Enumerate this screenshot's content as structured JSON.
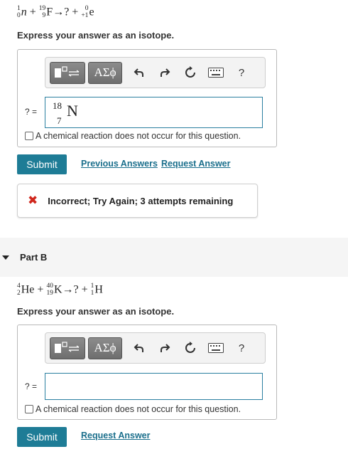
{
  "partA": {
    "equation": {
      "neutron": {
        "mass": "1",
        "atomic": "0",
        "symbol": "n"
      },
      "plus1": "+",
      "fluorine": {
        "mass": "19",
        "atomic": "9",
        "symbol": "F"
      },
      "arrow": "→",
      "unknown": "?",
      "plus2": "+",
      "positron": {
        "mass": "0",
        "atomic": "+1",
        "symbol": "e"
      }
    },
    "instruction": "Express your answer as an isotope.",
    "toolbar": {
      "greek_label": "ΑΣϕ",
      "help_label": "?"
    },
    "answer_label": "? =",
    "answer": {
      "mass": "18",
      "atomic": "7",
      "symbol": "N"
    },
    "no_reaction_label": "A chemical reaction does not occur for this question.",
    "submit_label": "Submit",
    "previous_answers_label": "Previous Answers",
    "request_answer_label": "Request Answer",
    "feedback": {
      "icon": "✖",
      "text": "Incorrect; Try Again; 3 attempts remaining",
      "icon_color": "#d0271d"
    }
  },
  "partB": {
    "title": "Part B",
    "equation": {
      "helium": {
        "mass": "4",
        "atomic": "2",
        "symbol": "He"
      },
      "plus1": "+",
      "potassium": {
        "mass": "40",
        "atomic": "19",
        "symbol": "K"
      },
      "arrow": "→",
      "unknown": "?",
      "plus2": "+",
      "hydrogen": {
        "mass": "1",
        "atomic": "1",
        "symbol": "H"
      }
    },
    "instruction": "Express your answer as an isotope.",
    "toolbar": {
      "greek_label": "ΑΣϕ",
      "help_label": "?"
    },
    "answer_label": "? =",
    "answer_value": "",
    "no_reaction_label": "A chemical reaction does not occur for this question.",
    "submit_label": "Submit",
    "request_answer_label": "Request Answer"
  },
  "colors": {
    "accent": "#1e7c96",
    "link": "#1b6f8c",
    "input_border": "#2a7fa0",
    "error": "#d0271d"
  }
}
